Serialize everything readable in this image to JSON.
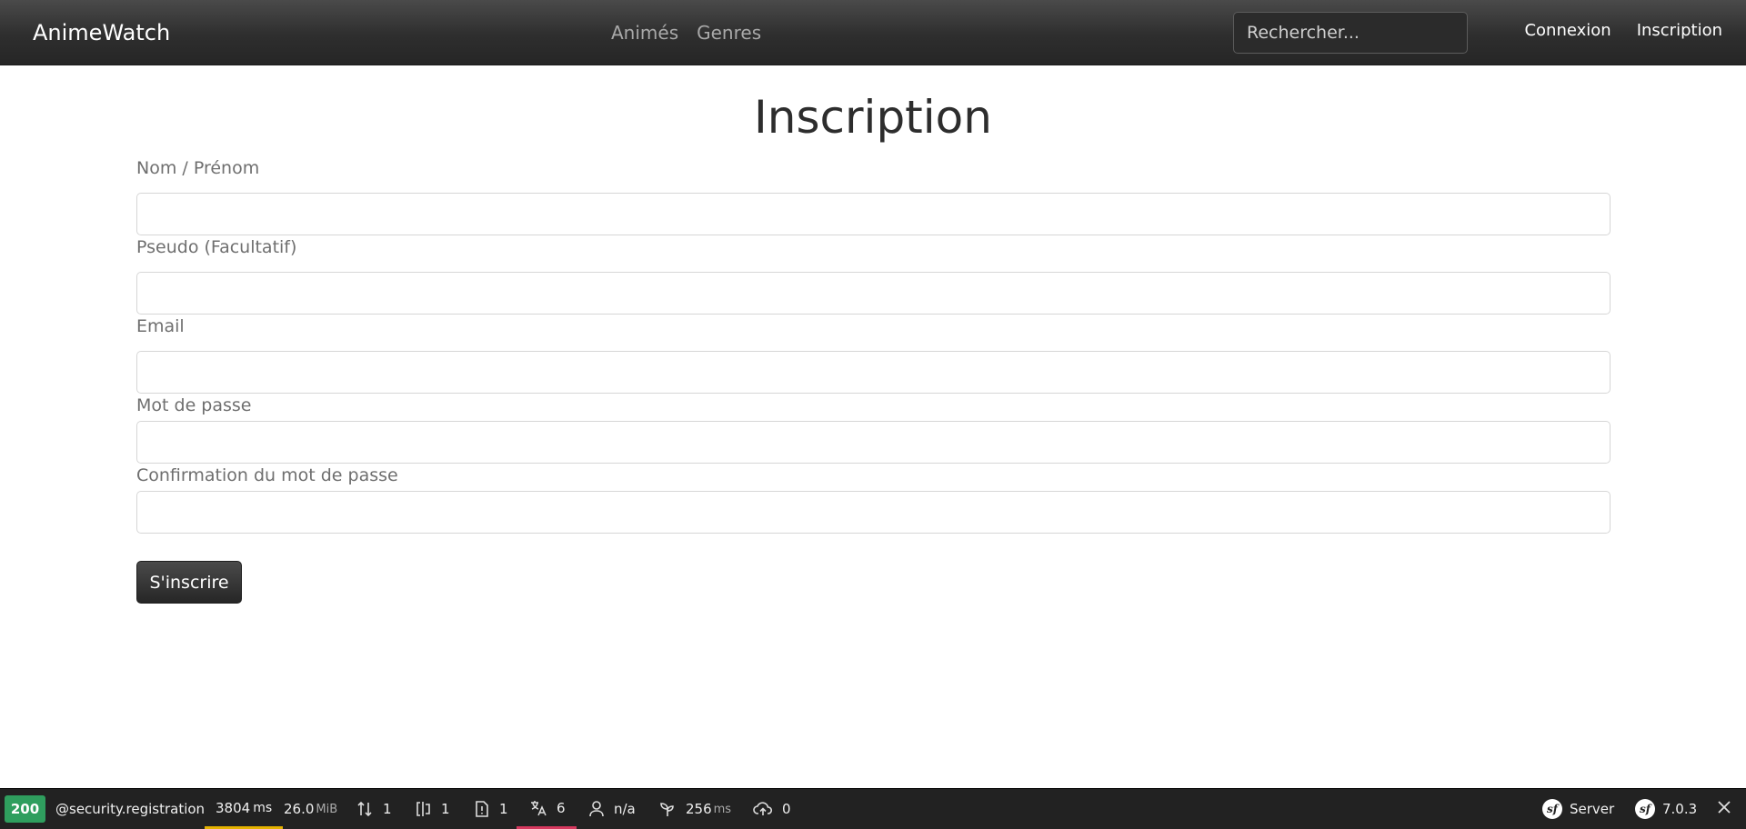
{
  "navbar": {
    "brand": "AnimeWatch",
    "links": [
      "Animés",
      "Genres"
    ],
    "search_placeholder": "Rechercher...",
    "login": "Connexion",
    "register": "Inscription"
  },
  "form": {
    "title": "Inscription",
    "fields": [
      {
        "label": "Nom / Prénom",
        "value": ""
      },
      {
        "label": "Pseudo (Facultatif)",
        "value": ""
      },
      {
        "label": "Email",
        "value": ""
      },
      {
        "label": "Mot de passe",
        "value": ""
      },
      {
        "label": "Confirmation du mot de passe",
        "value": ""
      }
    ],
    "submit": "S'inscrire"
  },
  "toolbar": {
    "status": "200",
    "route": "@security.registration",
    "time_value": "3804",
    "time_unit": "ms",
    "memory_value": "26.0",
    "memory_unit": "MiB",
    "requests": "1",
    "forms": "1",
    "logs": "1",
    "translations": "6",
    "user": "n/a",
    "twig_value": "256",
    "twig_unit": "ms",
    "uploads": "0",
    "server_label": "Server",
    "symfony_version": "7.0.3",
    "status_color": "#2f9e5e"
  }
}
